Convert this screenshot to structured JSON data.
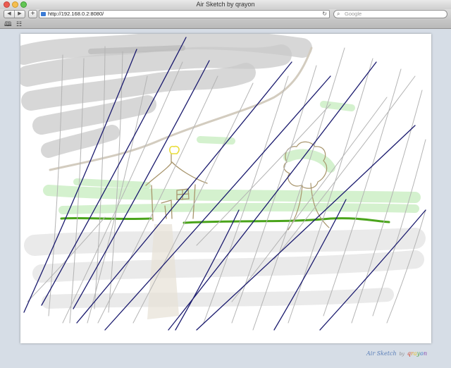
{
  "window": {
    "title": "Air Sketch by qrayon"
  },
  "toolbar": {
    "back_icon": "◀",
    "forward_icon": "▶",
    "add_icon": "+",
    "url": "http://192.168.0.2:8080/",
    "reload_icon": "↻",
    "search_icon": "⌕",
    "search_placeholder": "Google"
  },
  "bookmarks": {
    "book_icon": "🕮",
    "grid_icon": "☷"
  },
  "sketch": {
    "description_colors": {
      "sky": "#c9c9c9",
      "grass": "#4aa41b",
      "foliage": "#b9ecb0",
      "house": "#a8956c",
      "sun": "#e9dd3a",
      "rain_dark": "#1a1a6e",
      "rain_light": "#b4b4b4"
    }
  },
  "brand": {
    "app": "Air Sketch",
    "by": "by",
    "q": "q",
    "r": "r",
    "a": "a",
    "y": "y",
    "o": "o",
    "n": "n"
  }
}
